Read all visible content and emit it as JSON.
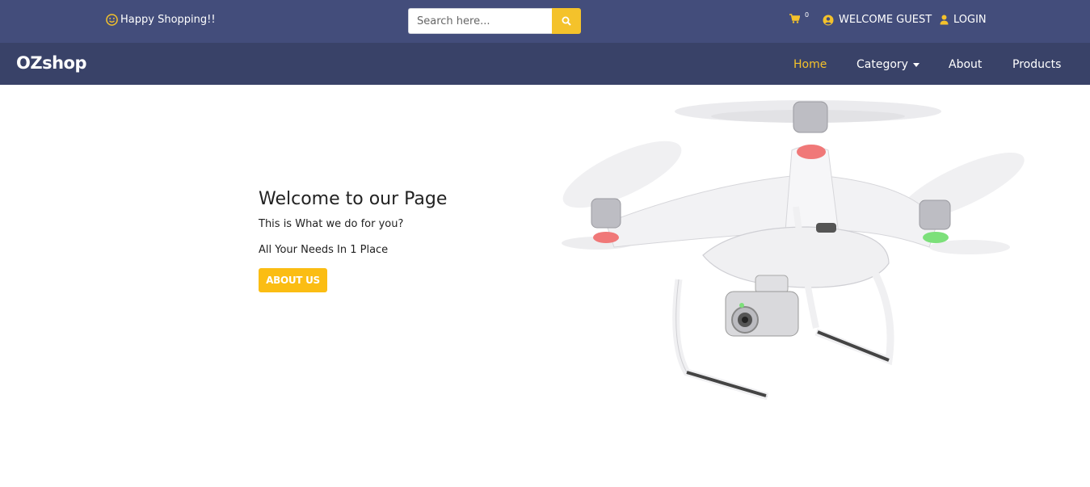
{
  "topbar": {
    "greeting": "Happy Shopping!!",
    "search_placeholder": "Search here...",
    "cart_count": "0",
    "welcome": "WELCOME GUEST",
    "login": "LOGIN"
  },
  "navbar": {
    "brand": "OZshop",
    "items": [
      {
        "label": "Home",
        "active": true
      },
      {
        "label": "Category"
      },
      {
        "label": "About"
      },
      {
        "label": "Products"
      }
    ]
  },
  "hero": {
    "title": "Welcome to our Page",
    "subtitle": "This is What we do for you?",
    "tagline": "All Your Needs In 1 Place",
    "button": "ABOUT US"
  },
  "colors": {
    "topbar": "#434d7b",
    "navbar": "#394268",
    "accent": "#f4c22b",
    "button": "#fbbd13"
  },
  "icons": [
    "smile-icon",
    "search-icon",
    "cart-icon",
    "user-circle-icon",
    "user-icon",
    "caret-down-icon"
  ]
}
